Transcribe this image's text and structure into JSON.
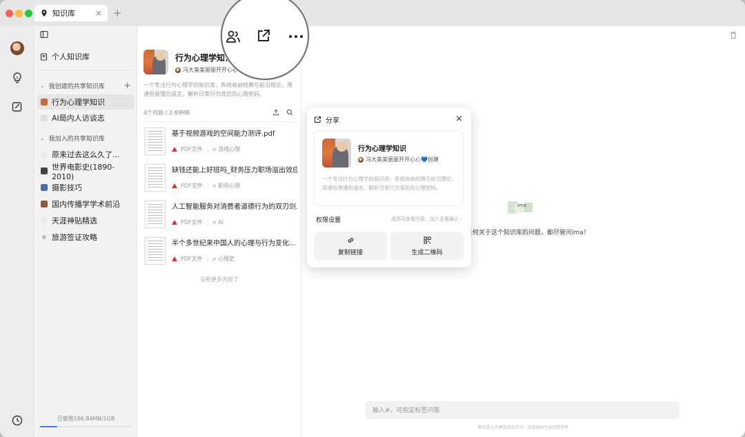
{
  "tab": {
    "title": "知识库",
    "close": "×",
    "add": "+"
  },
  "sidebar": {
    "personal": "个人知识库",
    "section_created": "我创建的共享知识库",
    "section_joined": "我加入的共享知识库",
    "created_items": [
      {
        "label": "行为心理学知识",
        "color": "#c76a3b"
      },
      {
        "label": "AI局内人访谈志",
        "color": "#d0d0d0"
      }
    ],
    "joined_items": [
      {
        "label": "原来过去这么久了...",
        "color": "#e9e9e9"
      },
      {
        "label": "世界电影史(1890-2010)",
        "color": "#444444"
      },
      {
        "label": "摄影技巧",
        "color": "#4b6ea8"
      },
      {
        "label": "国内传播学学术前沿",
        "color": "#8a5a3a"
      },
      {
        "label": "天涯神贴精选",
        "color": "#e9e9e9"
      },
      {
        "label": "旅游签证攻略",
        "color": "#bbbbbb"
      }
    ],
    "usage": "已使用196.84MB/1GB",
    "usage_fraction": 0.19
  },
  "kb": {
    "title": "行为心理学知识",
    "author": "冯大美美丽丽开开心心💙创建 ·",
    "desc": "一个专注行为心理学的知识库，系统收纳经典与前沿理论，用通俗易懂的语言，解析日常行为背后的心理密码。",
    "meta": "4个内容 / 2.69MB",
    "no_more": "没有更多内容了",
    "docs": [
      {
        "title": "基于视频游戏的空间能力测评.pdf",
        "type": "PDF文件",
        "tag": "游戏心理"
      },
      {
        "title": "缺钱还能上好班吗_财务压力职场溢出效应...",
        "type": "PDF文件",
        "tag": "职场心理"
      },
      {
        "title": "人工智能服务对消费者道德行为的双刃剑...",
        "type": "PDF文件",
        "tag": "AI"
      },
      {
        "title": "半个多世纪来中国人的心理与行为变化...",
        "type": "PDF文件",
        "tag": "心理史"
      }
    ]
  },
  "chat": {
    "ask_hint": "任何关于这个知识库的问题，都尽管问ima！",
    "logo_text": "ima",
    "input_placeholder": "输入#，可指定标签问答",
    "footer": "腾讯混元大模型提供支持｜内容由AI生成仅供参考"
  },
  "share": {
    "title": "分享",
    "close": "×",
    "card_title": "行为心理学知识",
    "card_author": "冯大美美丽丽开开心心💙创建",
    "card_desc": "一个专注行为心理学的知识库，系统收纳经典与前沿理论，用通俗易懂的语言，解析日常行为背后的心理密码。",
    "perm_label": "权限设置",
    "perm_value": "成员可查看内容，加入无需确认 ›",
    "copy_link": "复制链接",
    "qr_code": "生成二维码"
  },
  "colors": {
    "accent": "#3a7bff",
    "pdf": "#e5322d"
  }
}
